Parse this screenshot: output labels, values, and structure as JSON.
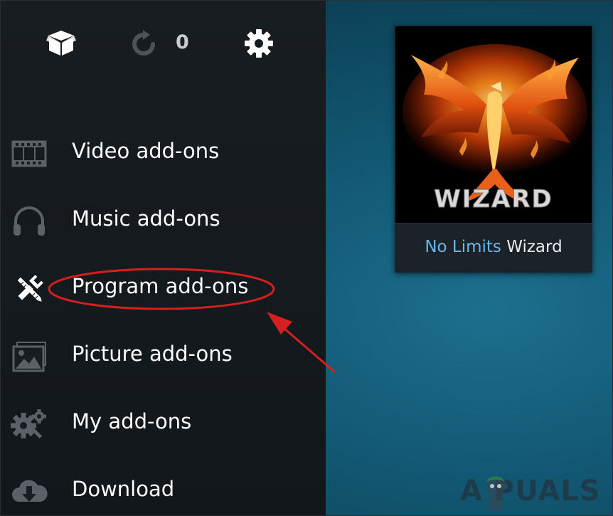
{
  "topbar": {
    "update_count": "0"
  },
  "menu": {
    "items": [
      {
        "label": "Video add-ons",
        "icon": "film-strip-icon"
      },
      {
        "label": "Music add-ons",
        "icon": "headphones-icon"
      },
      {
        "label": "Program add-ons",
        "icon": "tools-icon"
      },
      {
        "label": "Picture add-ons",
        "icon": "pictures-icon"
      },
      {
        "label": "My add-ons",
        "icon": "gears-icon"
      },
      {
        "label": "Download",
        "icon": "cloud-download-icon"
      }
    ]
  },
  "featured_addon": {
    "art_text": "WIZARD",
    "caption_accent": "No Limits",
    "caption_rest": "Wizard"
  },
  "watermark": {
    "text": "A  PUALS"
  },
  "colors": {
    "sidebar_bg": "#151a1e",
    "content_bg": "#135a76",
    "caption_accent": "#6bb4e6",
    "annotation_red": "#d61f1f"
  }
}
